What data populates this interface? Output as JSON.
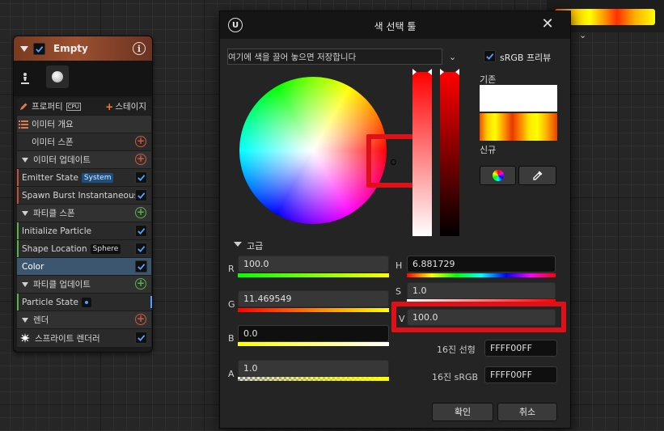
{
  "emitter": {
    "title": "Empty",
    "header_color": "#9c5030",
    "properties_label": "프로퍼티",
    "cpu_badge": "CPU",
    "stage_label": "스테이지",
    "stage_plus": "+",
    "overview_label": "이미터 개요",
    "spawn_label": "이미터 스폰",
    "update_label": "이미터 업데이트",
    "emitter_state_label": "Emitter State",
    "emitter_state_tag": "System",
    "spawn_burst_label": "Spawn Burst Instantaneous",
    "particle_spawn_label": "파티클 스폰",
    "initialize_particle_label": "Initialize Particle",
    "shape_location_label": "Shape Location",
    "shape_location_tag": "Sphere",
    "color_label": "Color",
    "particle_update_label": "파티클 업데이트",
    "particle_state_label": "Particle State",
    "render_label": "렌더",
    "sprite_renderer_label": "스프라이트 렌더러",
    "info_glyph": "i",
    "plus_glyph": "+"
  },
  "dialog": {
    "title": "색 선택 툴",
    "close_glyph": "✕",
    "logo_glyph": "U",
    "theme_placeholder": "여기에 색을 끌어 놓으면 저장합니다",
    "chevron_glyph": "⌄",
    "srgb_preview_label": "sRGB 프리뷰",
    "srgb_checked": true,
    "old_label": "기존",
    "new_label": "신규",
    "old_color": "#FFFFFF",
    "advanced_label": "고급",
    "channels": {
      "r": {
        "label": "R",
        "value": "100.0"
      },
      "g": {
        "label": "G",
        "value": "11.469549"
      },
      "b": {
        "label": "B",
        "value": "0.0"
      },
      "a": {
        "label": "A",
        "value": "1.0"
      },
      "h": {
        "label": "H",
        "value": "6.881729"
      },
      "s": {
        "label": "S",
        "value": "1.0"
      },
      "v": {
        "label": "V",
        "value": "100.0"
      }
    },
    "hex_linear_label": "16진 선형",
    "hex_linear_value": "FFFF00FF",
    "hex_srgb_label": "16진 sRGB",
    "hex_srgb_value": "FFFF00FF",
    "ok_label": "확인",
    "cancel_label": "취소",
    "highlight_color": "#E01018"
  },
  "background_node": {
    "chevron_glyph": "⌄"
  }
}
